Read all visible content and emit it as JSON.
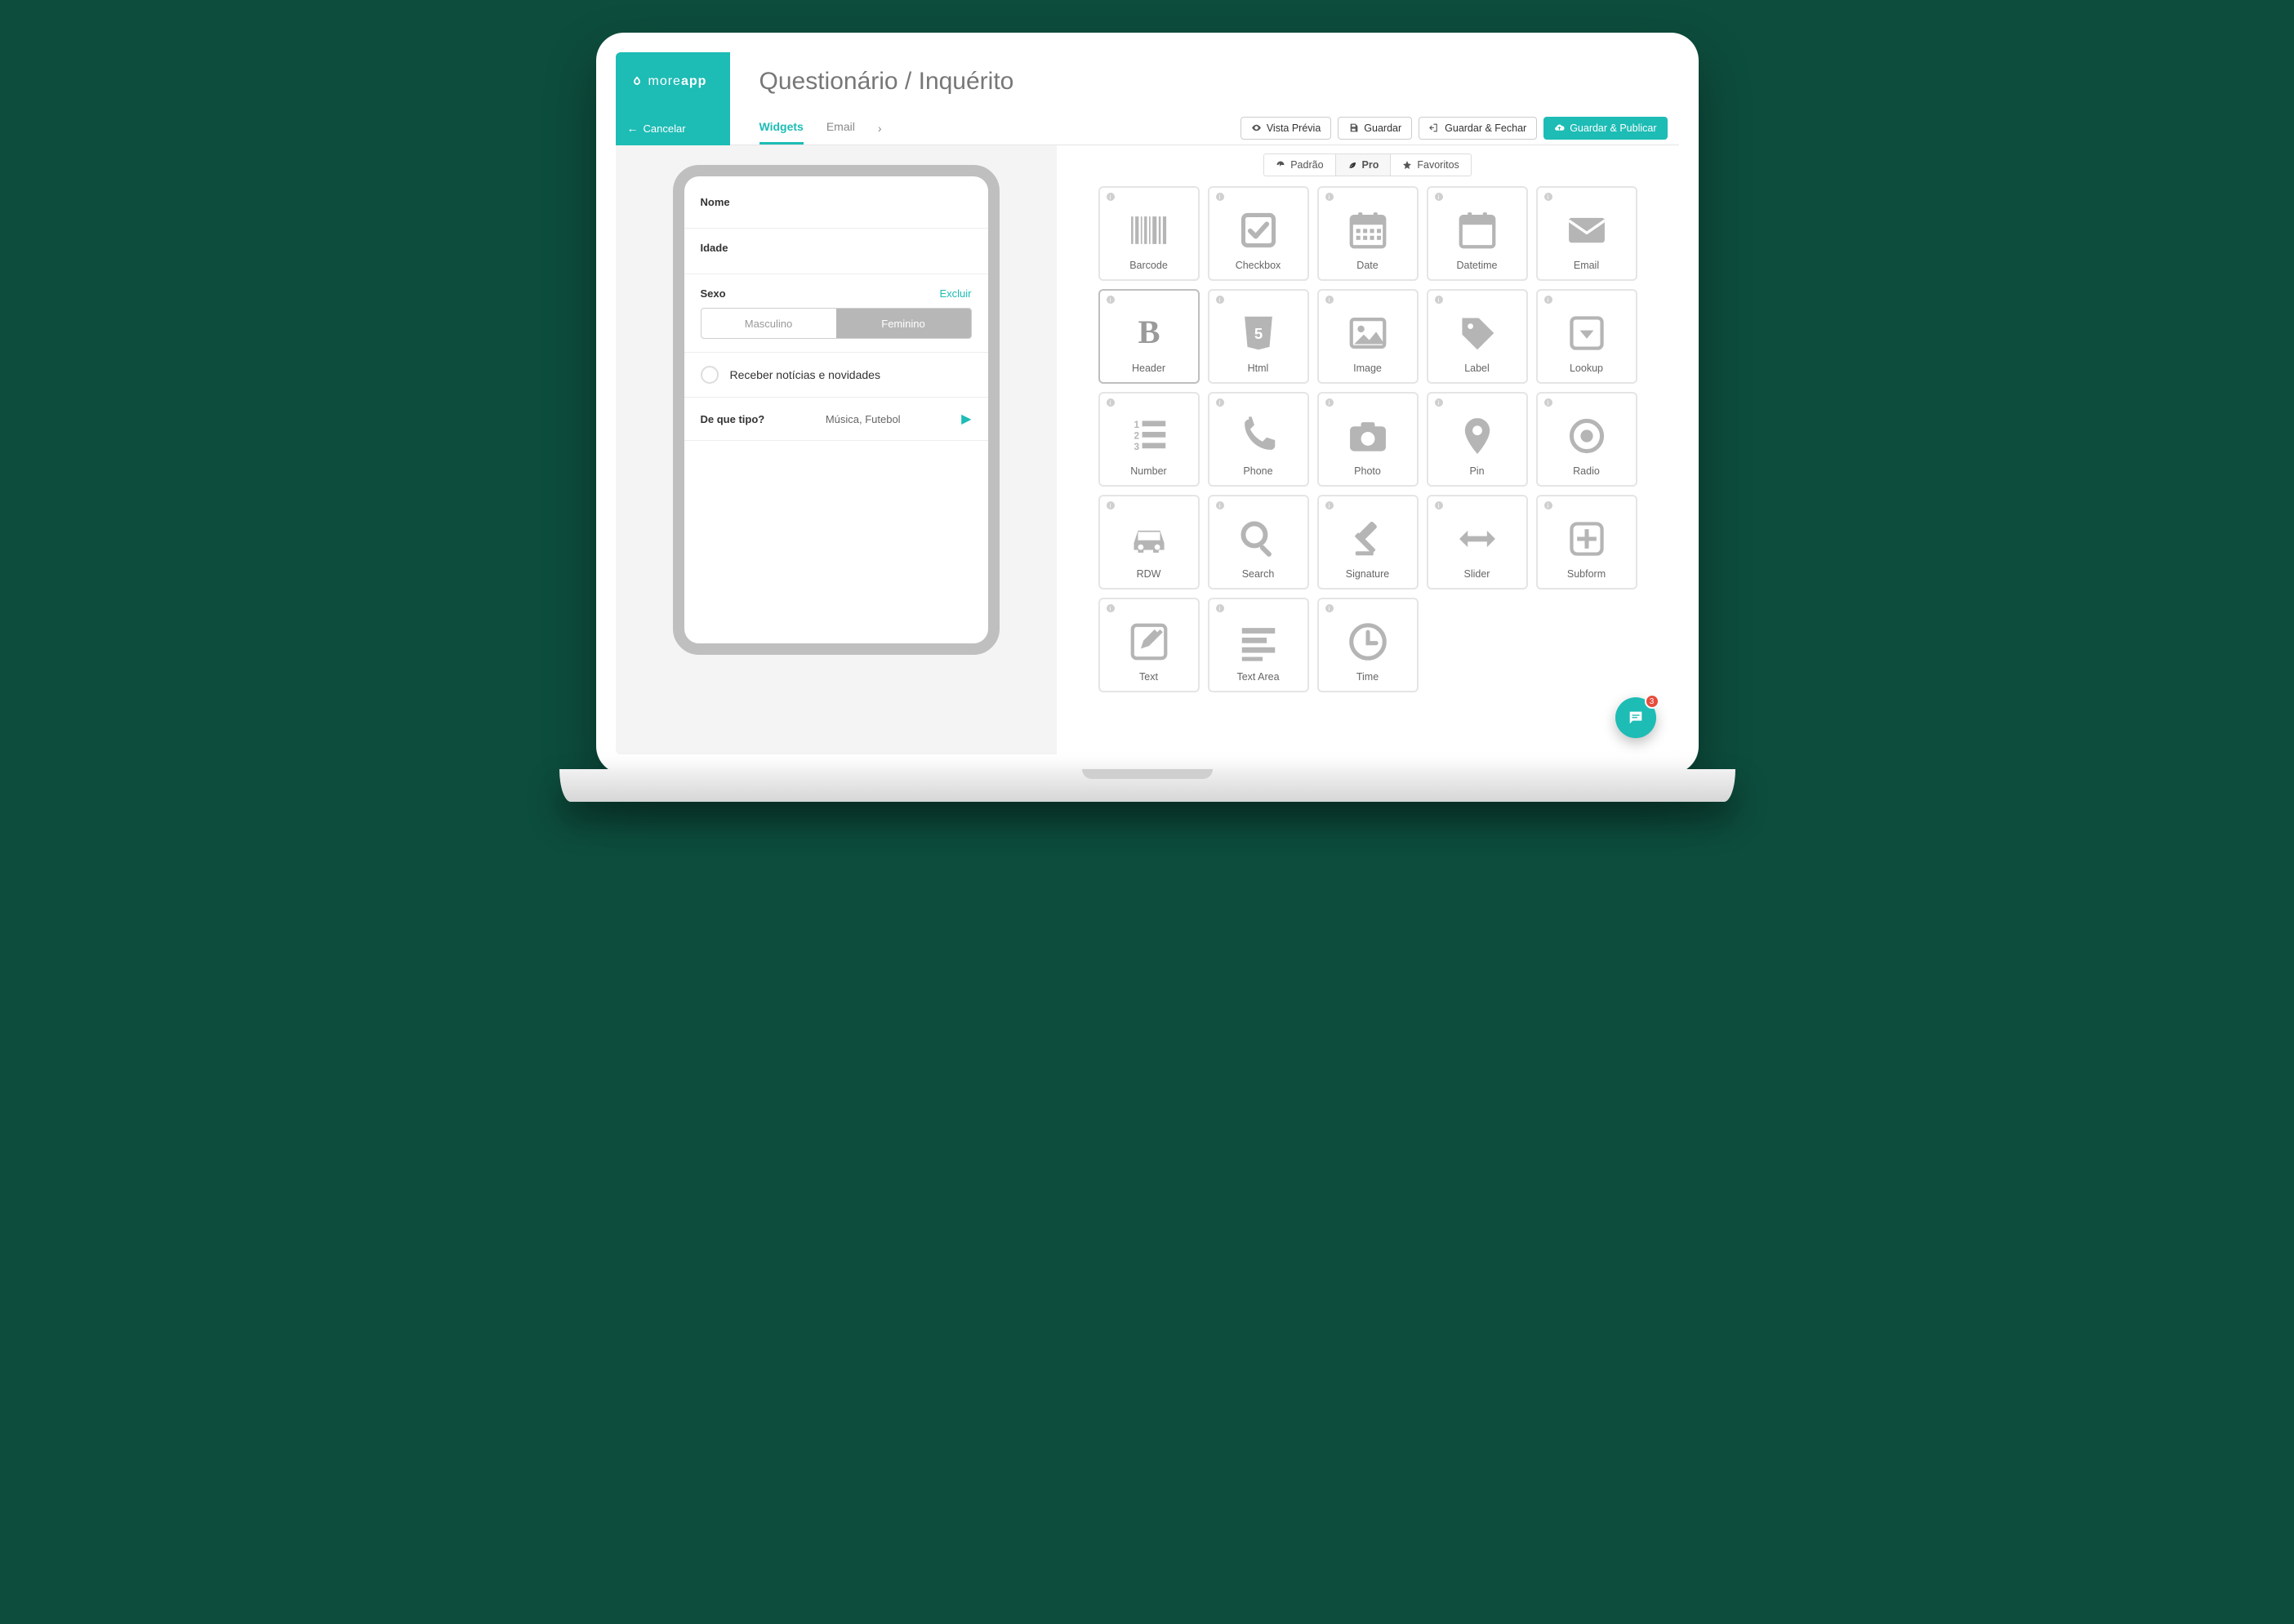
{
  "brand": {
    "text_light": "more",
    "text_bold": "app"
  },
  "cancel_label": "Cancelar",
  "page_title": "Questionário / Inquérito",
  "tabs": {
    "widgets": "Widgets",
    "email": "Email"
  },
  "toolbar": {
    "preview": "Vista Prévia",
    "save": "Guardar",
    "save_close": "Guardar & Fechar",
    "save_publish": "Guardar & Publicar"
  },
  "form": {
    "nome_label": "Nome",
    "idade_label": "Idade",
    "sexo_label": "Sexo",
    "excluir_label": "Excluir",
    "sexo_options": {
      "m": "Masculino",
      "f": "Feminino"
    },
    "check_label": "Receber notícias e novidades",
    "tipo_label": "De que tipo?",
    "tipo_value": "Música, Futebol"
  },
  "palette_tabs": {
    "padrao": "Padrão",
    "pro": "Pro",
    "favoritos": "Favoritos"
  },
  "widgets": {
    "barcode": "Barcode",
    "checkbox": "Checkbox",
    "date": "Date",
    "datetime": "Datetime",
    "email": "Email",
    "header": "Header",
    "html": "Html",
    "image": "Image",
    "label": "Label",
    "lookup": "Lookup",
    "number": "Number",
    "phone": "Phone",
    "photo": "Photo",
    "pin": "Pin",
    "radio": "Radio",
    "rdw": "RDW",
    "search": "Search",
    "signature": "Signature",
    "slider": "Slider",
    "subform": "Subform",
    "text": "Text",
    "textarea": "Text Area",
    "time": "Time"
  },
  "chat": {
    "badge": "3"
  }
}
